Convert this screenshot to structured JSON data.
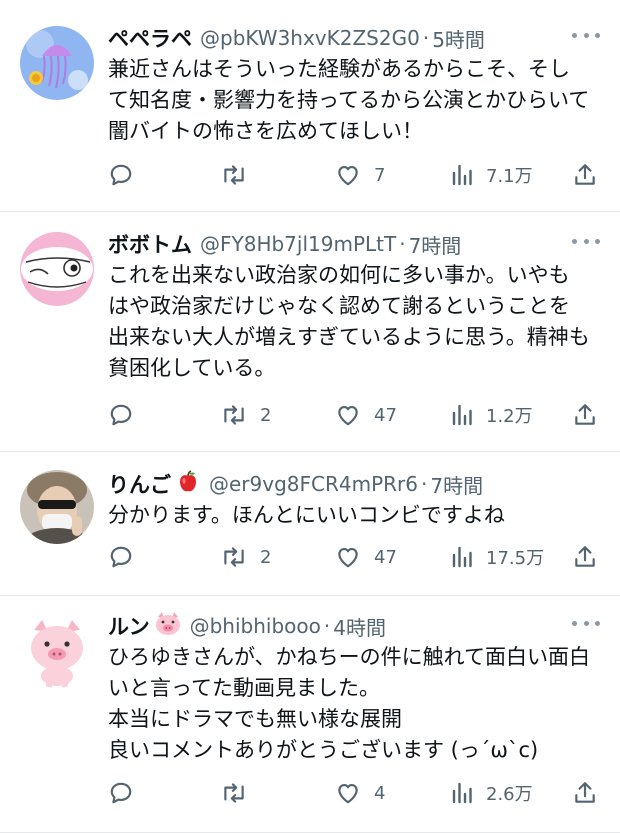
{
  "tweets": [
    {
      "name": "ペペラペ",
      "handle": "@pbKW3hxvK2ZS2G0",
      "separator": "·",
      "time": "5時間",
      "text": "兼近さんはそういった経験があるからこそ、そして知名度・影響力を持ってるから公演とかひらいて闇バイトの怖さを広めてほしい！",
      "retweets": "",
      "likes": "7",
      "views": "7.1万",
      "avatar_icon": "jellyfish-avatar"
    },
    {
      "name": "ボボトム",
      "handle": "@FY8Hb7jl19mPLtT",
      "separator": "·",
      "time": "7時間",
      "text": "これを出来ない政治家の如何に多い事か。いやもはや政治家だけじゃなく認めて謝るということを出来ない大人が増えすぎているように思う。精神も貧困化している。",
      "retweets": "2",
      "likes": "47",
      "views": "1.2万",
      "avatar_icon": "cartoon-face-avatar"
    },
    {
      "name": "りんご",
      "name_emoji": "apple-emoji",
      "handle": "@er9vg8FCR4mPRr6",
      "separator": "·",
      "time": "7時間",
      "text": "分かります。ほんとにいいコンビですよね",
      "retweets": "2",
      "likes": "47",
      "views": "17.5万",
      "avatar_icon": "person-photo-avatar"
    },
    {
      "name": "ルン",
      "name_emoji": "pig-emoji",
      "handle": "@bhibhibooo",
      "separator": "·",
      "time": "4時間",
      "text": "ひろゆきさんが、かねちーの件に触れて面白い面白いと言ってた動画見ました。\n本当にドラマでも無い様な展開\n良いコメントありがとうございます (っ´ω`c)",
      "retweets": "",
      "likes": "4",
      "views": "2.6万",
      "avatar_icon": "pig-avatar"
    }
  ],
  "colors": {
    "text": "#0f1419",
    "muted": "#536471",
    "divider": "#e6e8ea",
    "icon": "#536471"
  }
}
